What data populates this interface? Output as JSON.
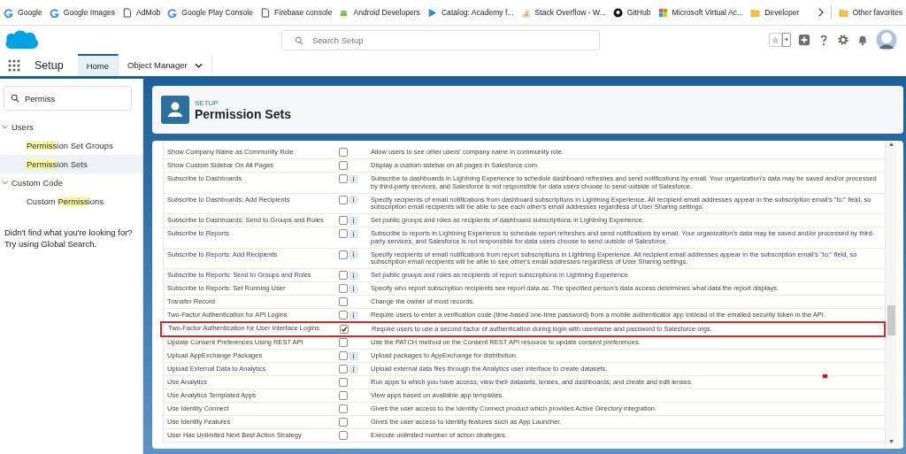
{
  "bookmarks": [
    {
      "kind": "google",
      "label": "Google"
    },
    {
      "kind": "google",
      "label": "Google Images"
    },
    {
      "kind": "page",
      "label": "AdMob"
    },
    {
      "kind": "google",
      "label": "Google Play Console"
    },
    {
      "kind": "page",
      "label": "Firebase console"
    },
    {
      "kind": "android",
      "label": "Android Developers"
    },
    {
      "kind": "play",
      "label": "Catalog: Academy f..."
    },
    {
      "kind": "stack",
      "label": "Stack Overflow - W..."
    },
    {
      "kind": "github",
      "label": "GitHub"
    },
    {
      "kind": "windows",
      "label": "Microsoft Virtual Ac..."
    },
    {
      "kind": "folder",
      "label": "Developer"
    }
  ],
  "other_bookmarks": {
    "label": "Other favorites"
  },
  "header": {
    "search": {
      "placeholder": "Search Setup"
    }
  },
  "nav": {
    "app": "Setup",
    "tabs": [
      {
        "label": "Home",
        "selected": true,
        "menu": false
      },
      {
        "label": "Object Manager",
        "selected": false,
        "menu": true
      }
    ]
  },
  "sidebar": {
    "search": {
      "value": "Permiss"
    },
    "groups": [
      {
        "label": "Users",
        "expanded": true,
        "children": [
          {
            "match": "Permiss",
            "after": "ion Set Groups",
            "selected": false
          },
          {
            "match": "Permiss",
            "after": "ion Sets",
            "selected": true
          }
        ]
      },
      {
        "label": "Custom Code",
        "expanded": true,
        "children": [
          {
            "before": "Custom ",
            "match": "Permiss",
            "after": "ions",
            "selected": false
          }
        ]
      }
    ],
    "hint": [
      "Didn't find what you're looking for?",
      "Try using Global Search."
    ]
  },
  "page_header": {
    "eyebrow": "SETUP",
    "title": "Permission Sets"
  },
  "permissions": [
    {
      "name": "Show Company Name as Community Role",
      "checked": false,
      "info": false,
      "highlighted": false,
      "description": "Allow users to see other users' company name in community role."
    },
    {
      "name": "Show Custom Sidebar On All Pages",
      "checked": false,
      "info": false,
      "highlighted": false,
      "description": "Display a custom sidebar on all pages in Salesforce.com."
    },
    {
      "name": "Subscribe to Dashboards",
      "checked": false,
      "info": true,
      "highlighted": false,
      "description": "Subscribe to dashboards in Lightning Experience to schedule dashboard refreshes and send notifications by email. Your organization's data may be saved and/or processed by third-party services, and Salesforce is not responsible for data users choose to send outside of Salesforce."
    },
    {
      "name": "Subscribe to Dashboards: Add Recipients",
      "checked": false,
      "info": true,
      "highlighted": false,
      "description": "Specify recipients of email notifications from dashboard subscriptions in Lightning Experience. All recipient email addresses appear in the subscription email's \"to:\" field, so subscription email recipients will be able to see each other's email addresses regardless of User Sharing settings."
    },
    {
      "name": "Subscribe to Dashboards: Send to Groups and Roles",
      "checked": false,
      "info": true,
      "highlighted": false,
      "description": "Set public groups and roles as recipients of dashboard subscriptions in Lightning Experience."
    },
    {
      "name": "Subscribe to Reports",
      "checked": false,
      "info": true,
      "highlighted": false,
      "description": "Subscribe to reports in Lightning Experience to schedule report refreshes and send notifications by email. Your organization's data may be saved and/or processed by third-party services, and Salesforce is not responsible for data users choose to send outside of Salesforce."
    },
    {
      "name": "Subscribe to Reports: Add Recipients",
      "checked": false,
      "info": true,
      "highlighted": false,
      "description": "Specify recipients of email notifications from report subscriptions in Lightning Experience. All recipient email addresses appear in the subscription email's \"to:\" field, so subscription email recipients will be able to see other's email addresses regardless of User Sharing settings."
    },
    {
      "name": "Subscribe to Reports: Send to Groups and Roles",
      "checked": false,
      "info": true,
      "highlighted": false,
      "description": "Set public groups and roles as recipients of report subscriptions in Lightning Experience."
    },
    {
      "name": "Subscribe to Reports: Set Running User",
      "checked": false,
      "info": true,
      "highlighted": false,
      "description": "Specify who report subscription recipients see report data as. The specified person's data access determines what data the report displays."
    },
    {
      "name": "Transfer Record",
      "checked": false,
      "info": false,
      "highlighted": false,
      "description": "Change the owner of most records."
    },
    {
      "name": "Two-Factor Authentication for API Logins",
      "checked": false,
      "info": true,
      "highlighted": false,
      "description": "Require users to enter a verification code (time-based one-time password) from a mobile authenticator app instead of the emailed security token in the API."
    },
    {
      "name": "Two-Factor Authentication for User Interface Logins",
      "checked": true,
      "info": false,
      "highlighted": true,
      "description": "Require users to use a second factor of authentication during login with username and password to Salesforce orgs."
    },
    {
      "name": "Update Consent Preferences Using REST API",
      "checked": false,
      "info": false,
      "highlighted": false,
      "description": "Use the PATCH method on the Consent REST API resource to update consent preferences."
    },
    {
      "name": "Upload AppExchange Packages",
      "checked": false,
      "info": true,
      "highlighted": false,
      "description": "Upload packages to AppExchange for distribution."
    },
    {
      "name": "Upload External Data to Analytics",
      "checked": false,
      "info": true,
      "highlighted": false,
      "description": "Upload external data files through the Analytics user interface to create datasets."
    },
    {
      "name": "Use Analytics",
      "checked": false,
      "info": false,
      "highlighted": false,
      "description": "Run apps to which you have access; view their datasets, lenses, and dashboards; and create and edit lenses."
    },
    {
      "name": "Use Analytics Templated Apps",
      "checked": false,
      "info": false,
      "highlighted": false,
      "description": "View apps based on available app templates."
    },
    {
      "name": "Use Identity Connect",
      "checked": false,
      "info": false,
      "highlighted": false,
      "description": "Gives the user access to the Identity Connect product which provides Active Directory integration."
    },
    {
      "name": "Use Identity Features",
      "checked": false,
      "info": false,
      "highlighted": false,
      "description": "Gives the user access to Identity features such as App Launcher."
    },
    {
      "name": "User Has Unlimited Next Best Action Strategy",
      "checked": false,
      "info": false,
      "highlighted": false,
      "description": "Execute unlimited number of action strategies."
    }
  ]
}
